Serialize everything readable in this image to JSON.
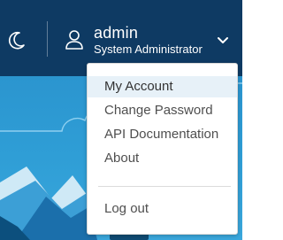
{
  "header": {
    "theme_toggle_icon": "moon-icon",
    "user_icon": "user-icon",
    "user": {
      "name": "admin",
      "role": "System Administrator"
    },
    "menu_toggle_icon": "chevron-down-icon"
  },
  "user_menu": {
    "items": [
      {
        "label": "My Account",
        "active": true
      },
      {
        "label": "Change Password",
        "active": false
      },
      {
        "label": "API Documentation",
        "active": false
      },
      {
        "label": "About",
        "active": false
      }
    ],
    "logout_label": "Log out"
  },
  "colors": {
    "header_bg": "#0e3a63",
    "scene_sky": "#2f9ed6",
    "menu_highlight": "#e7f1f8",
    "menu_text": "#4f4f4f"
  }
}
